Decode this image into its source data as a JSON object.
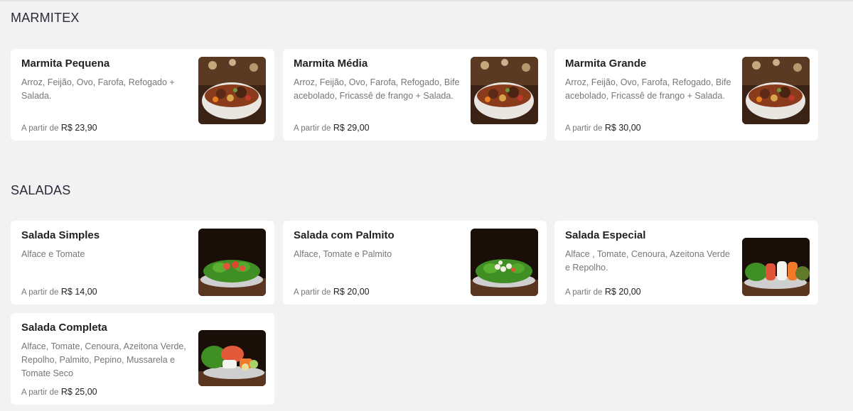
{
  "sections": [
    {
      "title": "MARMITEX",
      "items": [
        {
          "name": "Marmita Pequena",
          "description": "Arroz, Feijão, Ovo, Farofa, Refogado + Salada.",
          "price_prefix": "A partir de",
          "price": "R$ 23,90",
          "image_icon": "marmita-bowl-photo"
        },
        {
          "name": "Marmita Média",
          "description": "Arroz, Feijão, Ovo, Farofa, Refogado, Bife acebolado, Fricassê de frango + Salada.",
          "price_prefix": "A partir de",
          "price": "R$ 29,00",
          "image_icon": "marmita-bowl-photo"
        },
        {
          "name": "Marmita Grande",
          "description": "Arroz, Feijão, Ovo, Farofa, Refogado, Bife acebolado, Fricassê de frango + Salada.",
          "price_prefix": "A partir de",
          "price": "R$ 30,00",
          "image_icon": "marmita-bowl-photo"
        }
      ]
    },
    {
      "title": "SALADAS",
      "items": [
        {
          "name": "Salada Simples",
          "description": "Alface e Tomate",
          "price_prefix": "A partir de",
          "price": "R$ 14,00",
          "image_icon": "salad-plate-photo"
        },
        {
          "name": "Salada com Palmito",
          "description": "Alface, Tomate e Palmito",
          "price_prefix": "A partir de",
          "price": "R$ 20,00",
          "image_icon": "salad-plate-photo"
        },
        {
          "name": "Salada Especial",
          "description": "Alface , Tomate, Cenoura, Azeitona Verde e Repolho.",
          "price_prefix": "A partir de",
          "price": "R$ 20,00",
          "image_icon": "salad-plate-photo"
        },
        {
          "name": "Salada Completa",
          "description": "Alface, Tomate, Cenoura, Azeitona Verde, Repolho, Palmito, Pepino, Mussarela e Tomate Seco",
          "price_prefix": "A partir de",
          "price": "R$ 25,00",
          "image_icon": "salad-plate-photo"
        }
      ]
    }
  ],
  "colors": {
    "page_background": "#f2f2f2",
    "card_background": "#ffffff",
    "title_text": "#222222",
    "description_text": "#777777",
    "section_title": "#2a2a3a"
  }
}
